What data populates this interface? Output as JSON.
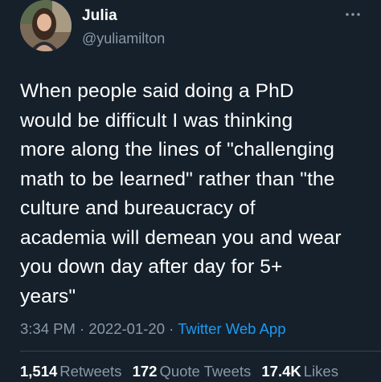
{
  "tweet": {
    "author_name": "Julia",
    "author_handle": "@yuliamilton",
    "text": "When people said doing a PhD\nwould be difficult I was thinking\nmore along the lines of \"challenging\nmath to be learned\" rather than \"the\nculture and bureaucracy of\nacademia will demean you and wear\nyou down day after day for 5+\nyears\"",
    "time": "3:34 PM",
    "date": "2022-01-20",
    "separator": "·",
    "source": "Twitter Web App",
    "stats": {
      "retweets_count": "1,514",
      "retweets_label": "Retweets",
      "quote_tweets_count": "172",
      "quote_tweets_label": "Quote Tweets",
      "likes_count": "17.4K",
      "likes_label": "Likes"
    }
  },
  "icons": {
    "avatar": "profile-photo",
    "more": "more-horizontal-icon"
  },
  "colors": {
    "background": "#15202b",
    "text_primary": "#ffffff",
    "text_secondary": "#8b98a5",
    "link": "#1d9bf0",
    "divider": "#38444d"
  }
}
